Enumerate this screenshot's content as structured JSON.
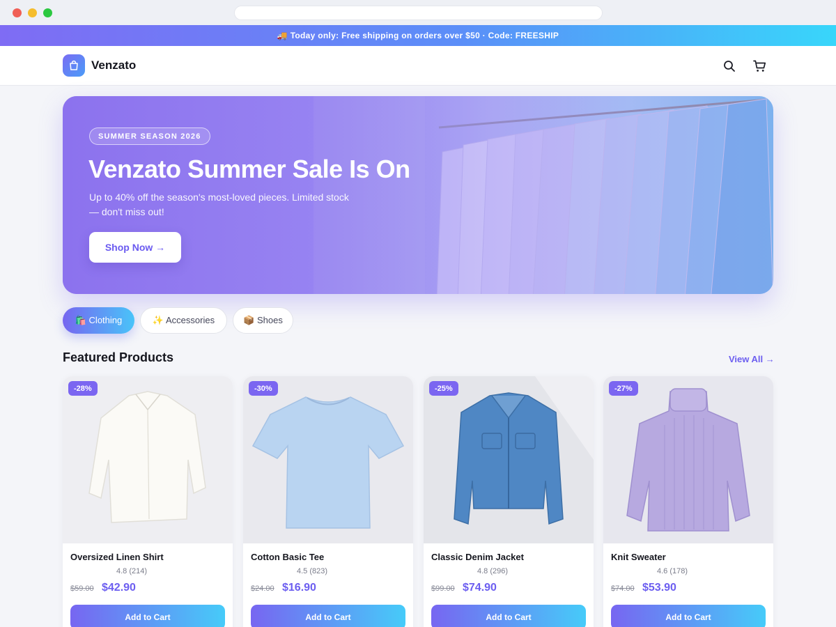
{
  "promo": {
    "text": "🚚 Today only: Free shipping on orders over $50 · Code: FREESHIP"
  },
  "header": {
    "brand": "Venzato"
  },
  "hero": {
    "badge": "SUMMER SEASON 2026",
    "title": "Venzato Summer Sale Is On",
    "subtitle": "Up to 40% off the season's most-loved pieces. Limited stock — don't miss out!",
    "cta": "Shop Now →"
  },
  "categories": [
    {
      "label": "🛍️ Clothing",
      "active": true
    },
    {
      "label": "✨ Accessories",
      "active": false
    },
    {
      "label": "📦 Shoes",
      "active": false
    }
  ],
  "featured": {
    "title": "Featured Products",
    "view_all": "View All →"
  },
  "products": [
    {
      "discount": "-28%",
      "name": "Oversized Linen Shirt",
      "rating": "4.8 (214)",
      "old_price": "$59.00",
      "price": "$42.90",
      "cta": "Add to Cart"
    },
    {
      "discount": "-30%",
      "name": "Cotton Basic Tee",
      "rating": "4.5 (823)",
      "old_price": "$24.00",
      "price": "$16.90",
      "cta": "Add to Cart"
    },
    {
      "discount": "-25%",
      "name": "Classic Denim Jacket",
      "rating": "4.8 (296)",
      "old_price": "$99.00",
      "price": "$74.90",
      "cta": "Add to Cart"
    },
    {
      "discount": "-27%",
      "name": "Knit Sweater",
      "rating": "4.6 (178)",
      "old_price": "$74.00",
      "price": "$53.90",
      "cta": "Add to Cart"
    }
  ],
  "colors": {
    "accent": "#6c5ef0",
    "gradient_start": "#7766f1",
    "gradient_end": "#46cbf9"
  },
  "icons": {
    "logo": "shopping-bag-icon",
    "search": "search-icon",
    "cart": "cart-icon"
  }
}
